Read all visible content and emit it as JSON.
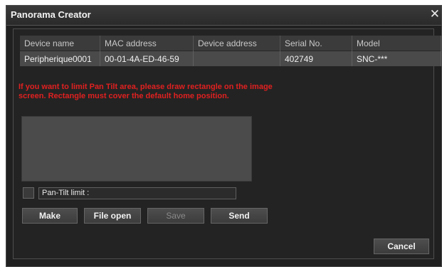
{
  "window": {
    "title": "Panorama Creator",
    "close_glyph": "✕"
  },
  "table": {
    "headers": [
      "Device name",
      "MAC address",
      "Device address",
      "Serial No.",
      "Model"
    ],
    "rows": [
      [
        "Peripherique0001",
        "00-01-4A-ED-46-59",
        "",
        "402749",
        "SNC-***"
      ]
    ]
  },
  "warning": {
    "line1": "If you want to limit Pan Tilt area, please draw rectangle on the image",
    "line2": "screen. Rectangle must cover the default home position."
  },
  "pantilt": {
    "label": "Pan-Tilt limit :",
    "checked": false
  },
  "buttons": {
    "make": "Make",
    "file_open": "File open",
    "save": "Save",
    "send": "Send",
    "cancel": "Cancel"
  },
  "colors": {
    "warning": "#e02020",
    "background": "#202020"
  }
}
